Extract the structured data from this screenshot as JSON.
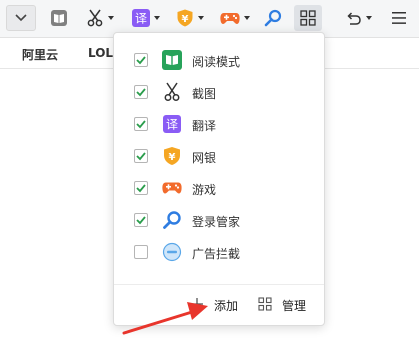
{
  "toolbar": {
    "buttons": [
      {
        "name": "menu-dropdown-button",
        "icon": "chevron-down-icon"
      },
      {
        "name": "reading-mode-button",
        "icon": "book-icon"
      },
      {
        "name": "screenshot-button",
        "icon": "scissors-icon"
      },
      {
        "name": "translate-button",
        "icon": "translate-icon",
        "glyph": "译"
      },
      {
        "name": "online-banking-button",
        "icon": "yuan-shield-icon",
        "glyph": "¥"
      },
      {
        "name": "games-button",
        "icon": "gamepad-icon"
      },
      {
        "name": "login-manager-button",
        "icon": "key-search-icon"
      },
      {
        "name": "apps-grid-button",
        "icon": "grid-icon"
      },
      {
        "name": "undo-button",
        "icon": "undo-icon"
      },
      {
        "name": "main-menu-button",
        "icon": "hamburger-icon"
      }
    ],
    "colors": {
      "reading_mode": "#808080",
      "translate": "#8a5cf5",
      "banking": "#f5a623",
      "games": "#f26b2c",
      "login": "#2f7de1"
    }
  },
  "bookmarks": {
    "items": [
      {
        "label": "阿里云"
      },
      {
        "label": "LOL"
      }
    ]
  },
  "popup": {
    "items": [
      {
        "label": "阅读模式",
        "checked": true,
        "icon": "reading-mode-icon"
      },
      {
        "label": "截图",
        "checked": true,
        "icon": "scissors-icon"
      },
      {
        "label": "翻译",
        "checked": true,
        "icon": "translate-icon",
        "glyph": "译"
      },
      {
        "label": "网银",
        "checked": true,
        "icon": "yuan-shield-icon",
        "glyph": "¥"
      },
      {
        "label": "游戏",
        "checked": true,
        "icon": "gamepad-icon"
      },
      {
        "label": "登录管家",
        "checked": true,
        "icon": "key-search-icon"
      },
      {
        "label": "广告拦截",
        "checked": false,
        "icon": "ad-block-icon"
      }
    ],
    "footer": {
      "add_label": "添加",
      "manage_label": "管理"
    },
    "colors": {
      "check": "#2a9d4c",
      "checkbox_border": "#b5b5b5",
      "reading_green": "#27a35a",
      "translate_purple": "#8a5cf5",
      "banking_orange": "#f5a623",
      "games_orange": "#f26b2c",
      "login_blue": "#2f7de1",
      "adblock_blue": "#5aa7e8"
    }
  },
  "annotation": {
    "arrow_color": "#e8352c"
  }
}
